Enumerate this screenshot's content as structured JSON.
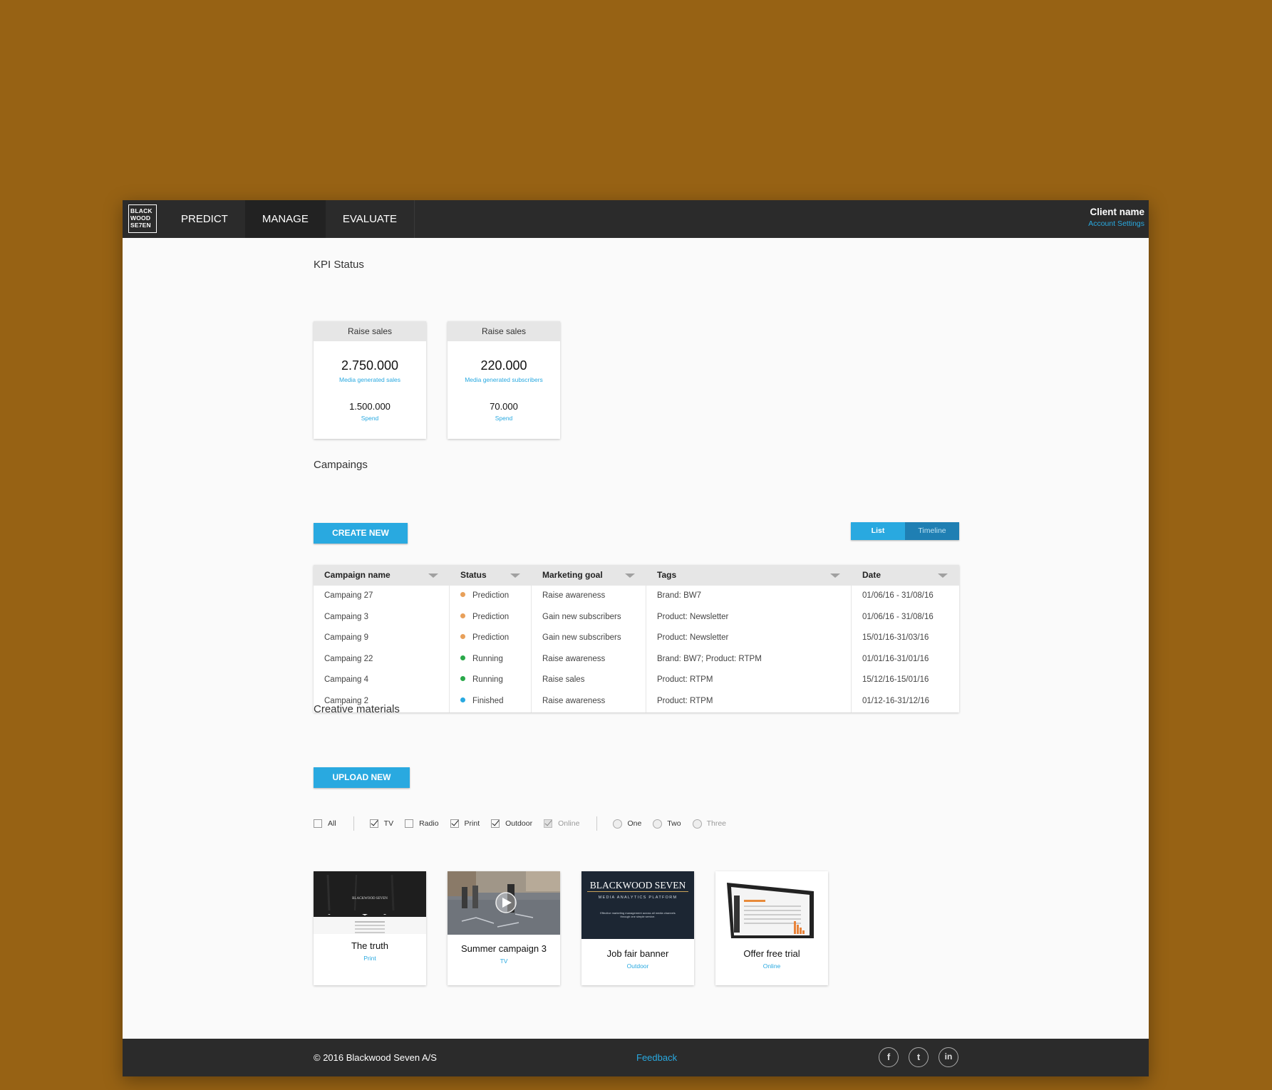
{
  "header": {
    "logo_lines": [
      "BLACK",
      "WOOD",
      "SE7EN"
    ],
    "nav": [
      "PREDICT",
      "MANAGE",
      "EVALUATE"
    ],
    "client_name": "Client name",
    "account_settings": "Account Settings"
  },
  "kpi": {
    "title": "KPI Status",
    "cards": [
      {
        "head": "Raise sales",
        "value": "2.750.000",
        "value_label": "Media generated sales",
        "spend": "1.500.000",
        "spend_label": "Spend"
      },
      {
        "head": "Raise sales",
        "value": "220.000",
        "value_label": "Media generated subscribers",
        "spend": "70.000",
        "spend_label": "Spend"
      }
    ]
  },
  "campaigns": {
    "title": "Campaings",
    "create_label": "CREATE NEW",
    "view_toggle": [
      "List",
      "Timeline"
    ],
    "columns": [
      "Campaign name",
      "Status",
      "Marketing goal",
      "Tags",
      "Date"
    ],
    "rows": [
      {
        "name": "Campaing 27",
        "status": "Prediction",
        "goal": "Raise awareness",
        "tags": "Brand: BW7",
        "date": "01/06/16 - 31/08/16"
      },
      {
        "name": "Campaing 3",
        "status": "Prediction",
        "goal": "Gain new subscribers",
        "tags": "Product: Newsletter",
        "date": "01/06/16 - 31/08/16"
      },
      {
        "name": "Campaing 9",
        "status": "Prediction",
        "goal": "Gain new subscribers",
        "tags": "Product: Newsletter",
        "date": "15/01/16-31/03/16"
      },
      {
        "name": "Campaing 22",
        "status": "Running",
        "goal": "Raise awareness",
        "tags": "Brand: BW7; Product: RTPM",
        "date": "01/01/16-31/01/16"
      },
      {
        "name": "Campaing 4",
        "status": "Running",
        "goal": "Raise sales",
        "tags": "Product: RTPM",
        "date": "15/12/16-15/01/16"
      },
      {
        "name": "Campaing 2",
        "status": "Finished",
        "goal": "Raise awareness",
        "tags": "Product: RTPM",
        "date": "01/12-16-31/12/16"
      }
    ],
    "status_colors": {
      "Prediction": "#e8a05a",
      "Running": "#2aa84a",
      "Finished": "#29a9e0"
    }
  },
  "creative": {
    "title": "Creative materials",
    "upload_label": "UPLOAD NEW",
    "filters": {
      "checkboxes": [
        {
          "label": "All",
          "checked": false
        },
        {
          "label": "TV",
          "checked": true
        },
        {
          "label": "Radio",
          "checked": false
        },
        {
          "label": "Print",
          "checked": true
        },
        {
          "label": "Outdoor",
          "checked": true
        },
        {
          "label": "Online",
          "checked": true,
          "disabled": true
        }
      ],
      "radios": [
        "One",
        "Two",
        "Three"
      ]
    },
    "cards": [
      {
        "title": "The truth",
        "type": "Print",
        "thumb_text": "BLACKWOOD SEVEN"
      },
      {
        "title": "Summer campaign 3",
        "type": "TV"
      },
      {
        "title": "Job fair banner",
        "type": "Outdoor",
        "thumb_title": "BLACKWOOD SEVEN",
        "thumb_sub": "MEDIA ANALYTICS PLATFORM",
        "thumb_body": "Effective marketing management across all media channels through one simple service."
      },
      {
        "title": "Offer free trial",
        "type": "Online"
      }
    ]
  },
  "footer": {
    "copyright": "© 2016 Blackwood Seven A/S",
    "feedback": "Feedback",
    "social": [
      "f",
      "t",
      "in"
    ]
  },
  "colors": {
    "accent": "#29a9e0",
    "background": "#976214",
    "nav": "#2b2b2b"
  }
}
